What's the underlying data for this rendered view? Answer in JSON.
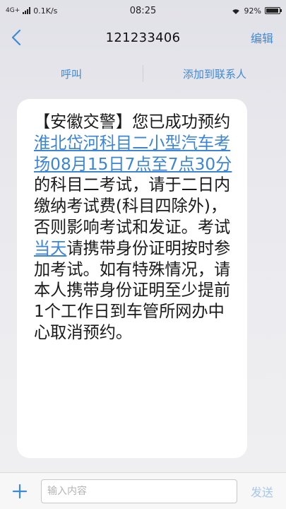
{
  "status_bar": {
    "network": "4G+",
    "speed": "0.1K/s",
    "time": "08:25",
    "battery": "92%",
    "battery_level": 0.92
  },
  "header": {
    "title": "121233406",
    "edit_label": "编辑"
  },
  "actions": {
    "call_label": "呼叫",
    "add_contact_label": "添加到联系人"
  },
  "message": {
    "part1": "【安徽交警】您已成功预约",
    "link1": "淮北岱河科目二小型汽车考场08月15日7点至7点30分",
    "part2": "的科目二考试，请于二日内缴纳考试费(科目四除外)，否则影响考试和发证。考试",
    "link2": "当天",
    "part3": "请携带身份证明按时参加考试。如有特殊情况，请本人携带身份证明至少提前1个工作日到车管所网办中心取消预约。"
  },
  "composer": {
    "placeholder": "输入内容",
    "send_label": "发送"
  },
  "colors": {
    "accent": "#3d8ad6",
    "link": "#3b85d4",
    "send_disabled": "#a7c7ea"
  }
}
